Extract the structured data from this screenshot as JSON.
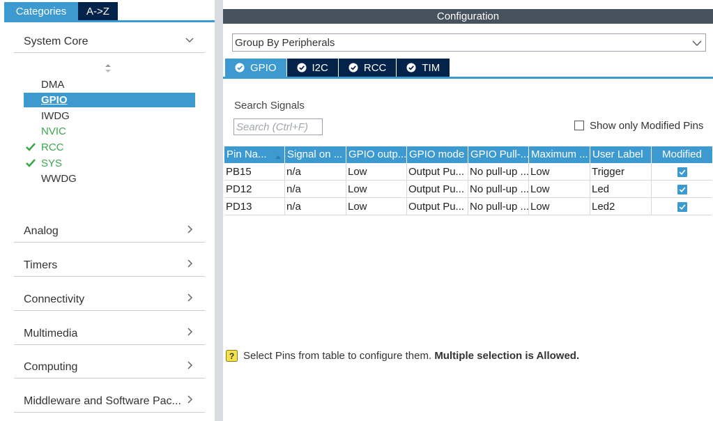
{
  "left": {
    "tabs": [
      {
        "label": "Categories"
      },
      {
        "label": "A->Z"
      }
    ],
    "categories": [
      {
        "label": "System Core",
        "expanded": true
      },
      {
        "label": "Analog"
      },
      {
        "label": "Timers"
      },
      {
        "label": "Connectivity"
      },
      {
        "label": "Multimedia"
      },
      {
        "label": "Computing"
      },
      {
        "label": "Middleware and Software Pac..."
      }
    ],
    "system_core_items": [
      {
        "label": "DMA",
        "state": "plain"
      },
      {
        "label": "GPIO",
        "state": "selected"
      },
      {
        "label": "IWDG",
        "state": "plain"
      },
      {
        "label": "NVIC",
        "state": "green"
      },
      {
        "label": "RCC",
        "state": "green-check"
      },
      {
        "label": "SYS",
        "state": "green-check"
      },
      {
        "label": "WWDG",
        "state": "plain"
      }
    ]
  },
  "right": {
    "header": "Configuration",
    "group_select": {
      "value": "Group By Peripherals"
    },
    "peripheral_tabs": [
      {
        "label": "GPIO",
        "active": true
      },
      {
        "label": "I2C"
      },
      {
        "label": "RCC"
      },
      {
        "label": "TIM"
      }
    ],
    "search": {
      "label": "Search Signals",
      "placeholder": "Search (Ctrl+F)"
    },
    "modified_only": {
      "label": "Show only Modified Pins",
      "checked": false
    },
    "table": {
      "columns": [
        "Pin Na...",
        "Signal on ...",
        "GPIO outp...",
        "GPIO mode",
        "GPIO Pull-...",
        "Maximum ...",
        "User Label",
        "Modified"
      ],
      "rows": [
        {
          "pin": "PB15",
          "signal": "n/a",
          "output": "Low",
          "mode": "Output Pu...",
          "pull": "No pull-up ...",
          "max": "Low",
          "label": "Trigger",
          "modified": true
        },
        {
          "pin": "PD12",
          "signal": "n/a",
          "output": "Low",
          "mode": "Output Pu...",
          "pull": "No pull-up ...",
          "max": "Low",
          "label": "Led",
          "modified": true
        },
        {
          "pin": "PD13",
          "signal": "n/a",
          "output": "Low",
          "mode": "Output Pu...",
          "pull": "No pull-up ...",
          "max": "Low",
          "label": "Led2",
          "modified": true
        }
      ]
    },
    "hint": {
      "text": "Select Pins from table to configure them.",
      "bold": "Multiple selection is Allowed."
    }
  },
  "colors": {
    "accent": "#3c9ad0",
    "navy": "#03234b",
    "header_gray": "#46525e",
    "green": "#3aa84a"
  },
  "icons": [
    "chevron-down-icon",
    "chevron-right-icon",
    "sort-arrows-icon",
    "check-icon",
    "shield-check-icon",
    "question-icon"
  ]
}
